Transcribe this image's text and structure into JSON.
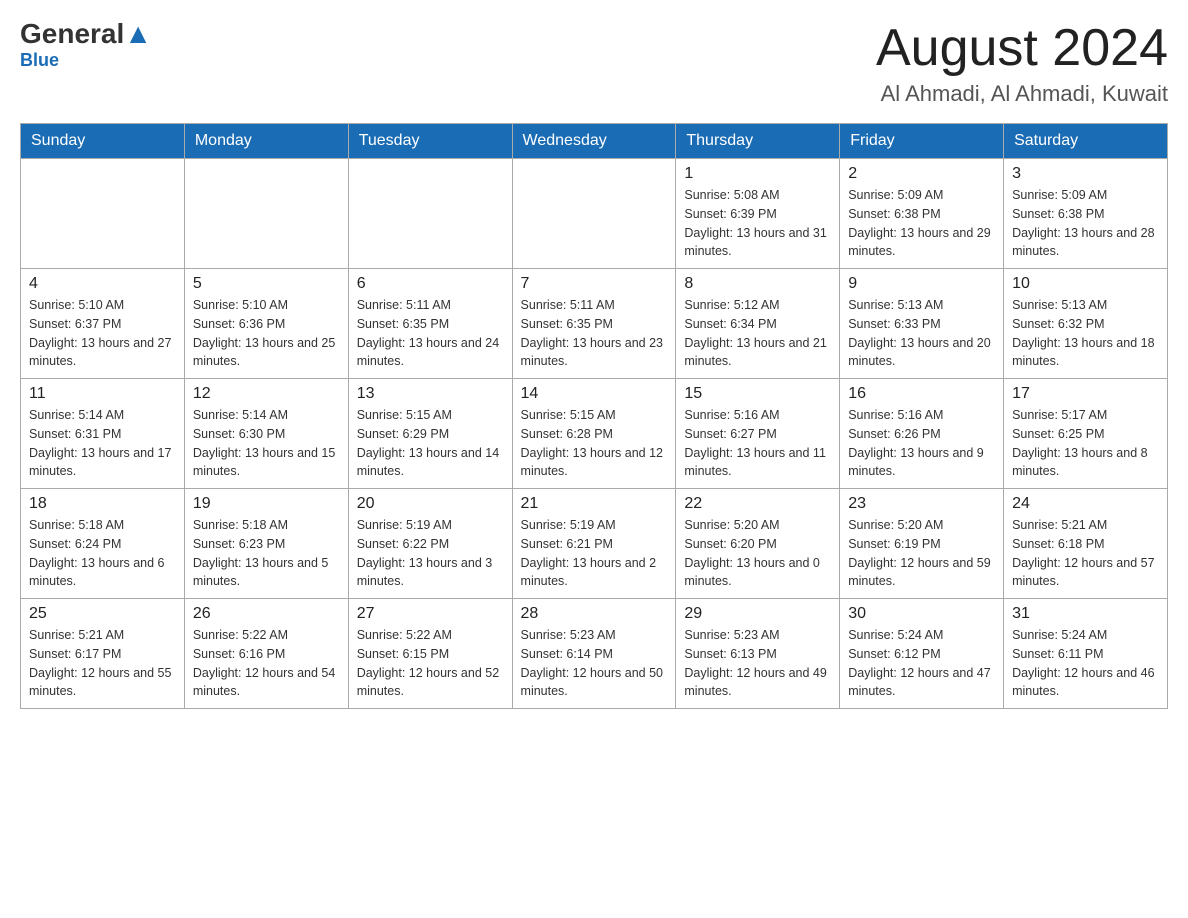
{
  "logo": {
    "general": "General",
    "blue": "Blue",
    "arrow": "▲"
  },
  "page": {
    "title": "August 2024",
    "subtitle": "Al Ahmadi, Al Ahmadi, Kuwait"
  },
  "weekdays": [
    "Sunday",
    "Monday",
    "Tuesday",
    "Wednesday",
    "Thursday",
    "Friday",
    "Saturday"
  ],
  "weeks": [
    [
      {
        "day": "",
        "info": ""
      },
      {
        "day": "",
        "info": ""
      },
      {
        "day": "",
        "info": ""
      },
      {
        "day": "",
        "info": ""
      },
      {
        "day": "1",
        "info": "Sunrise: 5:08 AM\nSunset: 6:39 PM\nDaylight: 13 hours and 31 minutes."
      },
      {
        "day": "2",
        "info": "Sunrise: 5:09 AM\nSunset: 6:38 PM\nDaylight: 13 hours and 29 minutes."
      },
      {
        "day": "3",
        "info": "Sunrise: 5:09 AM\nSunset: 6:38 PM\nDaylight: 13 hours and 28 minutes."
      }
    ],
    [
      {
        "day": "4",
        "info": "Sunrise: 5:10 AM\nSunset: 6:37 PM\nDaylight: 13 hours and 27 minutes."
      },
      {
        "day": "5",
        "info": "Sunrise: 5:10 AM\nSunset: 6:36 PM\nDaylight: 13 hours and 25 minutes."
      },
      {
        "day": "6",
        "info": "Sunrise: 5:11 AM\nSunset: 6:35 PM\nDaylight: 13 hours and 24 minutes."
      },
      {
        "day": "7",
        "info": "Sunrise: 5:11 AM\nSunset: 6:35 PM\nDaylight: 13 hours and 23 minutes."
      },
      {
        "day": "8",
        "info": "Sunrise: 5:12 AM\nSunset: 6:34 PM\nDaylight: 13 hours and 21 minutes."
      },
      {
        "day": "9",
        "info": "Sunrise: 5:13 AM\nSunset: 6:33 PM\nDaylight: 13 hours and 20 minutes."
      },
      {
        "day": "10",
        "info": "Sunrise: 5:13 AM\nSunset: 6:32 PM\nDaylight: 13 hours and 18 minutes."
      }
    ],
    [
      {
        "day": "11",
        "info": "Sunrise: 5:14 AM\nSunset: 6:31 PM\nDaylight: 13 hours and 17 minutes."
      },
      {
        "day": "12",
        "info": "Sunrise: 5:14 AM\nSunset: 6:30 PM\nDaylight: 13 hours and 15 minutes."
      },
      {
        "day": "13",
        "info": "Sunrise: 5:15 AM\nSunset: 6:29 PM\nDaylight: 13 hours and 14 minutes."
      },
      {
        "day": "14",
        "info": "Sunrise: 5:15 AM\nSunset: 6:28 PM\nDaylight: 13 hours and 12 minutes."
      },
      {
        "day": "15",
        "info": "Sunrise: 5:16 AM\nSunset: 6:27 PM\nDaylight: 13 hours and 11 minutes."
      },
      {
        "day": "16",
        "info": "Sunrise: 5:16 AM\nSunset: 6:26 PM\nDaylight: 13 hours and 9 minutes."
      },
      {
        "day": "17",
        "info": "Sunrise: 5:17 AM\nSunset: 6:25 PM\nDaylight: 13 hours and 8 minutes."
      }
    ],
    [
      {
        "day": "18",
        "info": "Sunrise: 5:18 AM\nSunset: 6:24 PM\nDaylight: 13 hours and 6 minutes."
      },
      {
        "day": "19",
        "info": "Sunrise: 5:18 AM\nSunset: 6:23 PM\nDaylight: 13 hours and 5 minutes."
      },
      {
        "day": "20",
        "info": "Sunrise: 5:19 AM\nSunset: 6:22 PM\nDaylight: 13 hours and 3 minutes."
      },
      {
        "day": "21",
        "info": "Sunrise: 5:19 AM\nSunset: 6:21 PM\nDaylight: 13 hours and 2 minutes."
      },
      {
        "day": "22",
        "info": "Sunrise: 5:20 AM\nSunset: 6:20 PM\nDaylight: 13 hours and 0 minutes."
      },
      {
        "day": "23",
        "info": "Sunrise: 5:20 AM\nSunset: 6:19 PM\nDaylight: 12 hours and 59 minutes."
      },
      {
        "day": "24",
        "info": "Sunrise: 5:21 AM\nSunset: 6:18 PM\nDaylight: 12 hours and 57 minutes."
      }
    ],
    [
      {
        "day": "25",
        "info": "Sunrise: 5:21 AM\nSunset: 6:17 PM\nDaylight: 12 hours and 55 minutes."
      },
      {
        "day": "26",
        "info": "Sunrise: 5:22 AM\nSunset: 6:16 PM\nDaylight: 12 hours and 54 minutes."
      },
      {
        "day": "27",
        "info": "Sunrise: 5:22 AM\nSunset: 6:15 PM\nDaylight: 12 hours and 52 minutes."
      },
      {
        "day": "28",
        "info": "Sunrise: 5:23 AM\nSunset: 6:14 PM\nDaylight: 12 hours and 50 minutes."
      },
      {
        "day": "29",
        "info": "Sunrise: 5:23 AM\nSunset: 6:13 PM\nDaylight: 12 hours and 49 minutes."
      },
      {
        "day": "30",
        "info": "Sunrise: 5:24 AM\nSunset: 6:12 PM\nDaylight: 12 hours and 47 minutes."
      },
      {
        "day": "31",
        "info": "Sunrise: 5:24 AM\nSunset: 6:11 PM\nDaylight: 12 hours and 46 minutes."
      }
    ]
  ]
}
